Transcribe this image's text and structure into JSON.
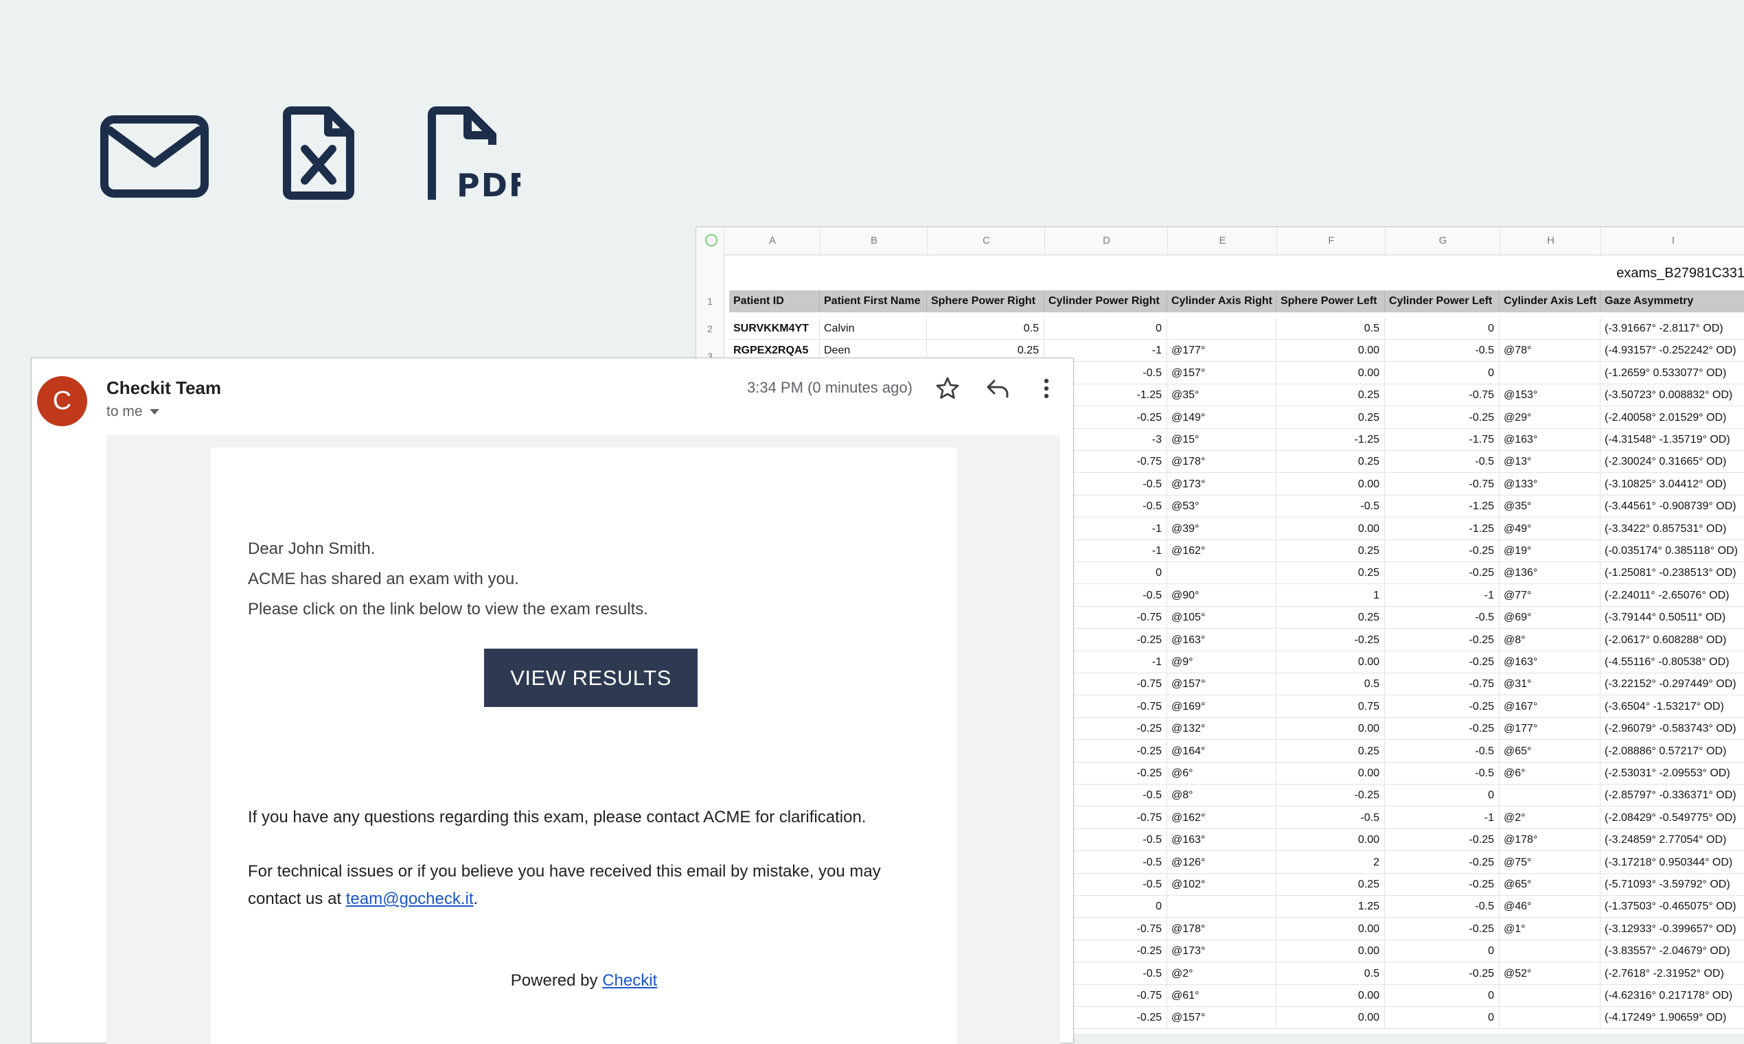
{
  "icons": {
    "mail": "envelope-icon",
    "excel": "excel-file-icon",
    "pdf": "pdf-file-icon",
    "pdf_label": "PDF",
    "color": "#1c2e4a"
  },
  "spreadsheet": {
    "title": "exams_B27981C331",
    "column_letters": [
      "A",
      "B",
      "C",
      "D",
      "E",
      "F",
      "G",
      "H",
      "I"
    ],
    "headers": [
      "Patient ID",
      "Patient First Name",
      "Sphere Power Right",
      "Cylinder Power Right",
      "Cylinder Axis Right",
      "Sphere Power Left",
      "Cylinder Power Left",
      "Cylinder Axis Left",
      "Gaze Asymmetry"
    ],
    "row_numbers": [
      "1",
      "2",
      "3"
    ],
    "rows": [
      [
        "SURVKKM4YT",
        "Calvin",
        "0.5",
        "0",
        "",
        "0.5",
        "0",
        "",
        "(-3.91667° -2.8117° OD)"
      ],
      [
        "RGPEX2RQA5",
        "Deen",
        "0.25",
        "-1",
        "@177°",
        "0.00",
        "-0.5",
        "@78°",
        "(-4.93157° -0.252242° OD)"
      ],
      [
        "",
        "",
        "",
        "-0.5",
        "@157°",
        "0.00",
        "0",
        "",
        "(-1.2659° 0.533077° OD)"
      ],
      [
        "",
        "",
        "",
        "-1.25",
        "@35°",
        "0.25",
        "-0.75",
        "@153°",
        "(-3.50723° 0.008832° OD)"
      ],
      [
        "",
        "",
        "",
        "-0.25",
        "@149°",
        "0.25",
        "-0.25",
        "@29°",
        "(-2.40058° 2.01529° OD)"
      ],
      [
        "",
        "",
        "",
        "-3",
        "@15°",
        "-1.25",
        "-1.75",
        "@163°",
        "(-4.31548° -1.35719° OD)"
      ],
      [
        "",
        "",
        "",
        "-0.75",
        "@178°",
        "0.25",
        "-0.5",
        "@13°",
        "(-2.30024° 0.31665° OD)"
      ],
      [
        "",
        "",
        "",
        "-0.5",
        "@173°",
        "0.00",
        "-0.75",
        "@133°",
        "(-3.10825° 3.04412° OD)"
      ],
      [
        "",
        "",
        "",
        "-0.5",
        "@53°",
        "-0.5",
        "-1.25",
        "@35°",
        "(-3.44561° -0.908739° OD)"
      ],
      [
        "",
        "",
        "",
        "-1",
        "@39°",
        "0.00",
        "-1.25",
        "@49°",
        "(-3.3422° 0.857531° OD)"
      ],
      [
        "",
        "",
        "",
        "-1",
        "@162°",
        "0.25",
        "-0.25",
        "@19°",
        "(-0.035174° 0.385118° OD)"
      ],
      [
        "",
        "",
        "",
        "0",
        "",
        "0.25",
        "-0.25",
        "@136°",
        "(-1.25081° -0.238513° OD)"
      ],
      [
        "",
        "",
        "",
        "-0.5",
        "@90°",
        "1",
        "-1",
        "@77°",
        "(-2.24011° -2.65076° OD)"
      ],
      [
        "",
        "",
        "",
        "-0.75",
        "@105°",
        "0.25",
        "-0.5",
        "@69°",
        "(-3.79144° 0.50511° OD)"
      ],
      [
        "",
        "",
        "",
        "-0.25",
        "@163°",
        "-0.25",
        "-0.25",
        "@8°",
        "(-2.0617° 0.608288° OD)"
      ],
      [
        "",
        "",
        "",
        "-1",
        "@9°",
        "0.00",
        "-0.25",
        "@163°",
        "(-4.55116° -0.80538° OD)"
      ],
      [
        "",
        "",
        "",
        "-0.75",
        "@157°",
        "0.5",
        "-0.75",
        "@31°",
        "(-3.22152° -0.297449° OD)"
      ],
      [
        "",
        "",
        "",
        "-0.75",
        "@169°",
        "0.75",
        "-0.25",
        "@167°",
        "(-3.6504° -1.53217° OD)"
      ],
      [
        "",
        "",
        "",
        "-0.25",
        "@132°",
        "0.00",
        "-0.25",
        "@177°",
        "(-2.96079° -0.583743° OD)"
      ],
      [
        "",
        "",
        "",
        "-0.25",
        "@164°",
        "0.25",
        "-0.5",
        "@65°",
        "(-2.08886° 0.57217° OD)"
      ],
      [
        "",
        "",
        "",
        "-0.25",
        "@6°",
        "0.00",
        "-0.5",
        "@6°",
        "(-2.53031° -2.09553° OD)"
      ],
      [
        "",
        "",
        "",
        "-0.5",
        "@8°",
        "-0.25",
        "0",
        "",
        "(-2.85797° -0.336371° OD)"
      ],
      [
        "",
        "",
        "",
        "-0.75",
        "@162°",
        "-0.5",
        "-1",
        "@2°",
        "(-2.08429° -0.549775° OD)"
      ],
      [
        "",
        "",
        "",
        "-0.5",
        "@163°",
        "0.00",
        "-0.25",
        "@178°",
        "(-3.24859° 2.77054° OD)"
      ],
      [
        "",
        "",
        "",
        "-0.5",
        "@126°",
        "2",
        "-0.25",
        "@75°",
        "(-3.17218° 0.950344° OD)"
      ],
      [
        "",
        "",
        "",
        "-0.5",
        "@102°",
        "0.25",
        "-0.25",
        "@65°",
        "(-5.71093° -3.59792° OD)"
      ],
      [
        "",
        "",
        "",
        "0",
        "",
        "1.25",
        "-0.5",
        "@46°",
        "(-1.37503° -0.465075° OD)"
      ],
      [
        "",
        "",
        "",
        "-0.75",
        "@178°",
        "0.00",
        "-0.25",
        "@1°",
        "(-3.12933° -0.399657° OD)"
      ],
      [
        "",
        "",
        "",
        "-0.25",
        "@173°",
        "0.00",
        "0",
        "",
        "(-3.83557° -2.04679° OD)"
      ],
      [
        "",
        "",
        "",
        "-0.5",
        "@2°",
        "0.5",
        "-0.25",
        "@52°",
        "(-2.7618° -2.31952° OD)"
      ],
      [
        "",
        "",
        "",
        "-0.75",
        "@61°",
        "0.00",
        "0",
        "",
        "(-4.62316° 0.217178° OD)"
      ],
      [
        "",
        "",
        "",
        "-0.25",
        "@157°",
        "0.00",
        "0",
        "",
        "(-4.17249° 1.90659° OD)"
      ]
    ]
  },
  "email": {
    "avatar_letter": "C",
    "avatar_color": "#c0391b",
    "sender": "Checkit Team",
    "to": "to me",
    "timestamp": "3:34 PM (0 minutes ago)",
    "greeting": "Dear John Smith.",
    "line1": "ACME has shared an exam with you.",
    "line2": "Please click on the link below to view the exam results.",
    "button_label": "VIEW RESULTS",
    "button_color": "#2e3a52",
    "questions": "If you have any questions regarding this exam, please contact ACME for clarification.",
    "technical_prefix": "For technical issues or if you believe you have received this email by mistake, you may contact us at ",
    "contact_email": "team@gocheck.it",
    "technical_suffix": ".",
    "powered_prefix": "Powered by ",
    "powered_link": "Checkit",
    "link_color": "#1a55c8"
  }
}
